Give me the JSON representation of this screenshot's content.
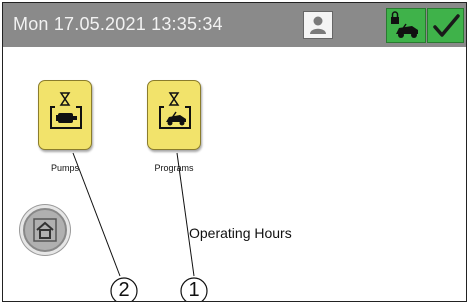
{
  "header": {
    "datetime": "Mon 17.05.2021  13:35:34"
  },
  "icons": {
    "user": "user-icon",
    "vehicle_lock": "vehicle-lock-icon",
    "confirm": "checkmark-icon",
    "pumps": "pump-hourglass-icon",
    "programs": "vehicle-hourglass-icon",
    "home": "home-icon"
  },
  "tiles": [
    {
      "label": "Pumps"
    },
    {
      "label": "Programs"
    }
  ],
  "main": {
    "title": "Operating Hours"
  },
  "callouts": [
    "2",
    "1"
  ],
  "colors": {
    "topbar": "#8a8a8a",
    "status_green": "#3fb24a",
    "tile_yellow": "#f2e36b"
  }
}
